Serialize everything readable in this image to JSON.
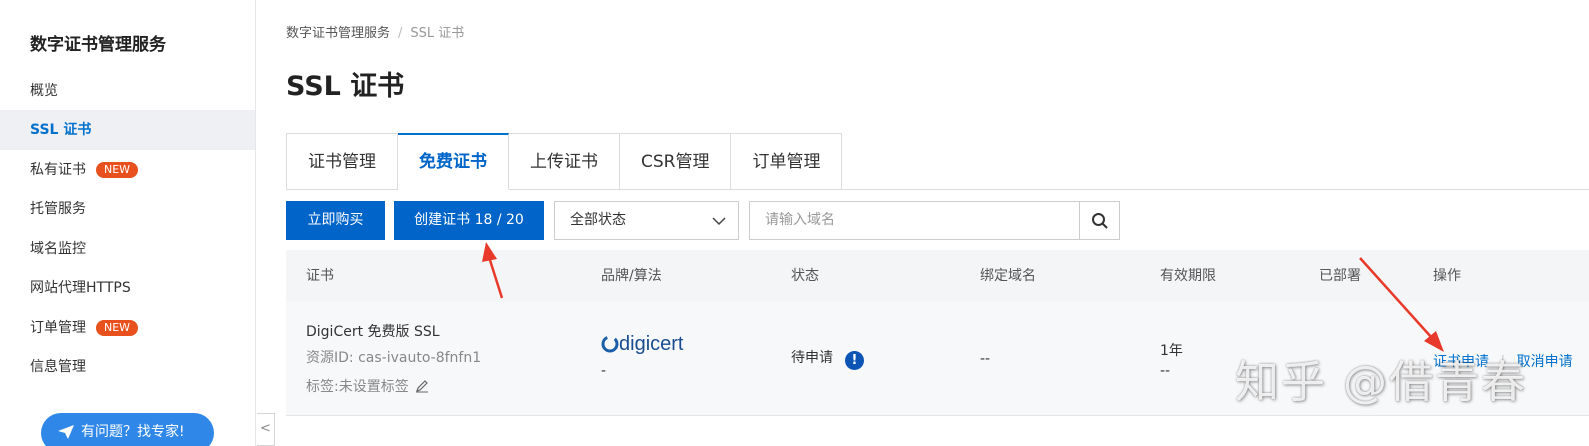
{
  "sidebar": {
    "title": "数字证书管理服务",
    "items": [
      {
        "label": "概览"
      },
      {
        "label": "SSL 证书"
      },
      {
        "label": "私有证书",
        "badge": "NEW"
      },
      {
        "label": "托管服务"
      },
      {
        "label": "域名监控"
      },
      {
        "label": "网站代理HTTPS"
      },
      {
        "label": "订单管理",
        "badge": "NEW"
      },
      {
        "label": "信息管理"
      }
    ],
    "help_button": "有问题？找专家!",
    "collapse_glyph": "<"
  },
  "breadcrumb": {
    "root": "数字证书管理服务",
    "separator": "/",
    "current": "SSL 证书"
  },
  "page_title": "SSL 证书",
  "tabs": [
    "证书管理",
    "免费证书",
    "上传证书",
    "CSR管理",
    "订单管理"
  ],
  "active_tab": "免费证书",
  "toolbar": {
    "buy_label": "立即购买",
    "create_label": "创建证书 18 / 20",
    "status_select": "全部状态",
    "search_placeholder": "请输入域名"
  },
  "table": {
    "headers": [
      "证书",
      "品牌/算法",
      "状态",
      "绑定域名",
      "有效期限",
      "已部署",
      "操作"
    ],
    "rows": [
      {
        "name": "DigiCert 免费版 SSL",
        "resource_id": "资源ID: cas-ivauto-8fnfn1",
        "tag": "标签:未设置标签",
        "brand": "digicert",
        "algorithm": "-",
        "status": "待申请",
        "domain": "--",
        "validity": "1年",
        "validity_sub": "--",
        "actions": [
          "证书申请",
          "取消申请"
        ]
      }
    ]
  },
  "watermark": "知乎 @借青春",
  "colors": {
    "primary": "#0064c8",
    "badge": "#e8501e",
    "arrow": "#e8392a"
  }
}
